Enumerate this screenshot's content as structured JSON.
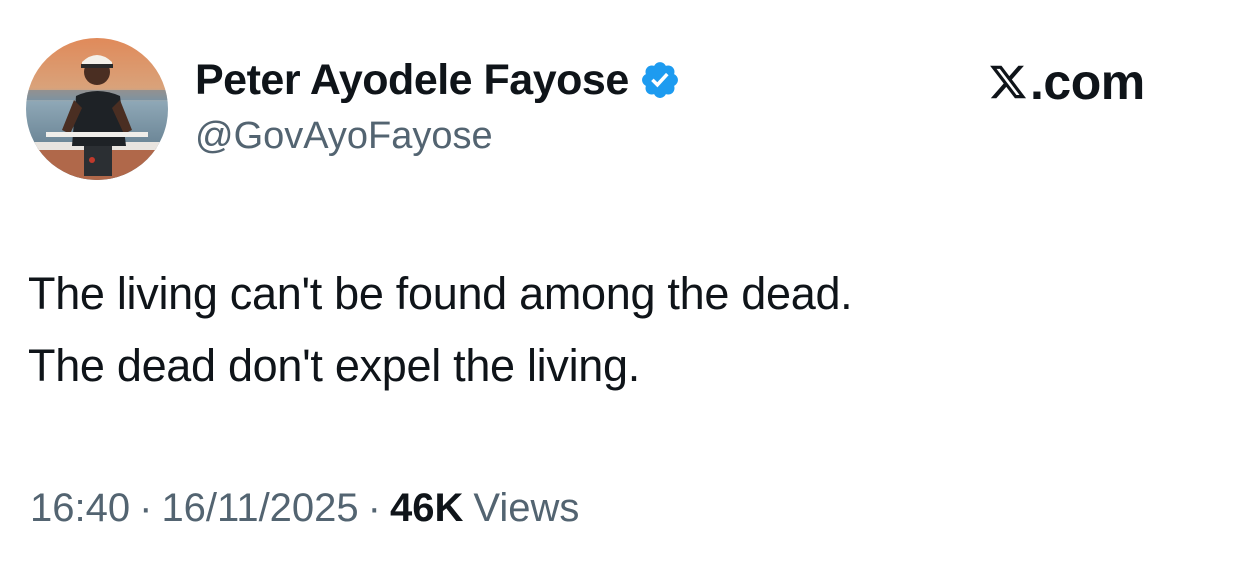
{
  "author": {
    "display_name": "Peter Ayodele Fayose",
    "handle": "@GovAyoFayose",
    "verified": true,
    "verified_color": "#1d9bf0"
  },
  "brand": {
    "icon": "x-logo-icon",
    "domain": ".com"
  },
  "tweet": {
    "lines": [
      "The living can't be found among the dead.",
      "The dead don't expel the living."
    ]
  },
  "meta": {
    "time": "16:40",
    "separator": "·",
    "date": "16/11/2025",
    "views_count": "46K",
    "views_label": "Views"
  },
  "colors": {
    "text_primary": "#0f1419",
    "text_secondary": "#536471",
    "background": "#ffffff"
  }
}
